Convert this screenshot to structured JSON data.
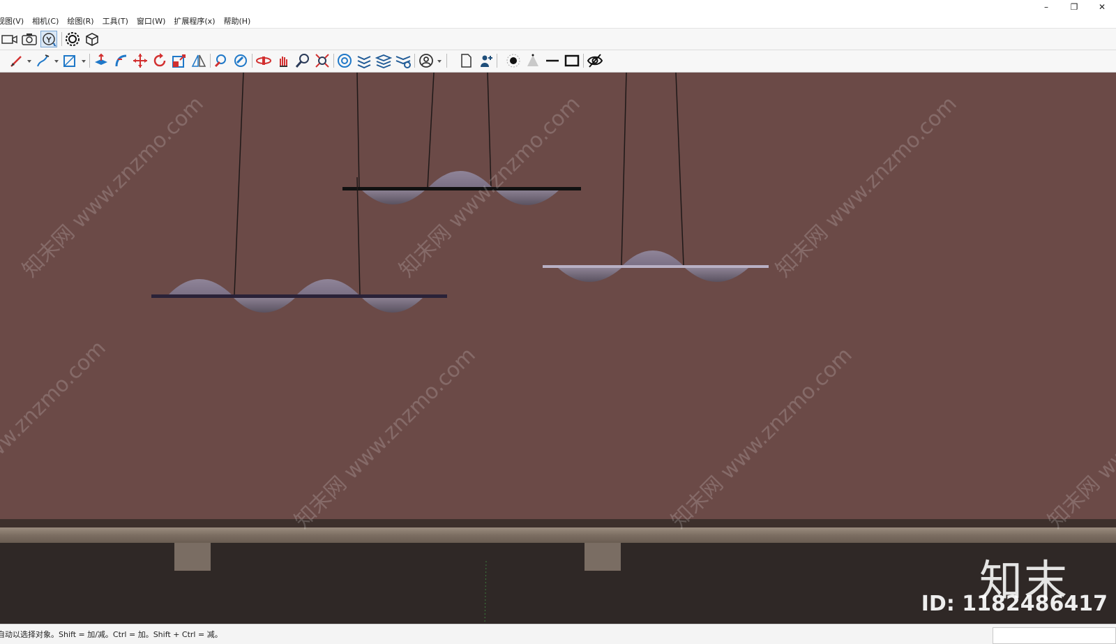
{
  "window": {
    "minimize": "–",
    "restore": "❐",
    "close": "✕"
  },
  "menu": [
    "视图(V)",
    "相机(C)",
    "绘图(R)",
    "工具(T)",
    "窗口(W)",
    "扩展程序(x)",
    "帮助(H)"
  ],
  "toolbar1": {
    "icons": [
      "camera-video-icon",
      "camera-photo-icon",
      "position-camera-icon",
      "settings-gear-icon",
      "component-box-icon"
    ],
    "active": "position-camera-icon"
  },
  "toolbar2": {
    "icons": [
      "pencil-icon",
      "freehand-pen-icon",
      "rectangle-icon",
      "push-pull-icon",
      "follow-me-icon",
      "move-icon",
      "rotate-icon",
      "scale-icon",
      "flip-icon",
      "paint-bucket-icon",
      "eraser-icon",
      "orbit-icon",
      "pan-icon",
      "zoom-icon",
      "zoom-extents-icon",
      "sandbox-icon",
      "stack-icon",
      "layers-icon",
      "layers-settings-icon",
      "user-circle-icon",
      "page-icon",
      "person-icon",
      "light-dot-icon",
      "cone-icon",
      "line-icon",
      "frame-icon",
      "hide-eye-icon"
    ]
  },
  "viewport": {
    "wall_color": "#6b4a47",
    "watermark": "知末网 www.znzmo.com",
    "logo": "知末",
    "id_label": "ID: 1182486417"
  },
  "statusbar": {
    "text": "自动以选择对象。Shift = 加/减。Ctrl = 加。Shift + Ctrl = 减。"
  }
}
